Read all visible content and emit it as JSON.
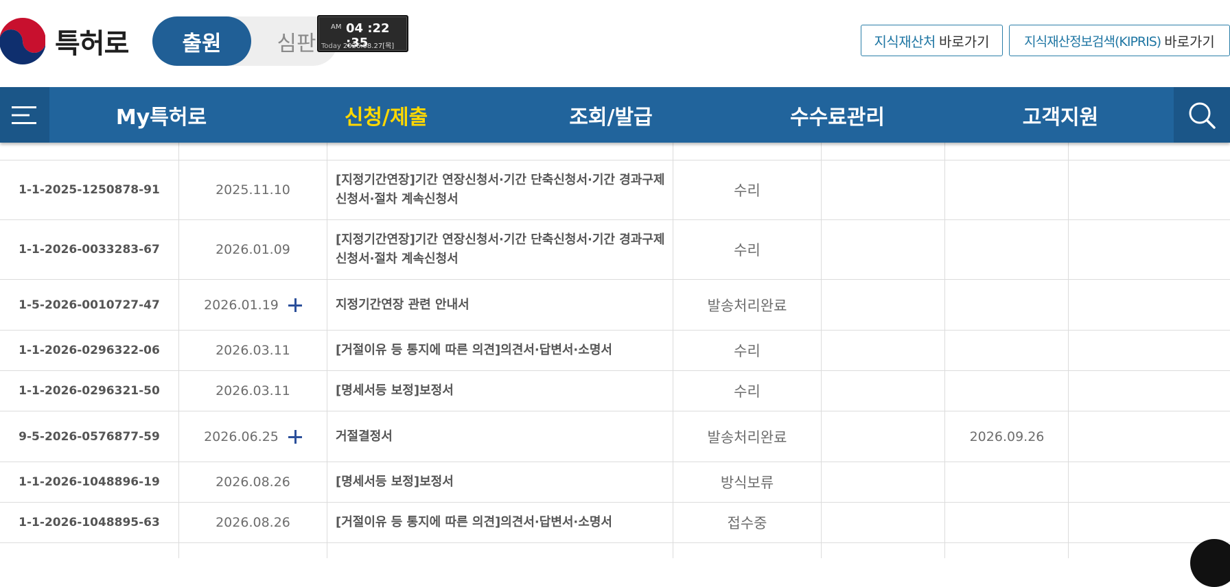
{
  "header": {
    "logo_text": "특허로",
    "modes": {
      "active": "출원",
      "inactive": "심판"
    },
    "clock": {
      "ampm": "AM",
      "time": "04 :22 :35",
      "today_label": "Today",
      "date": "2026.08.27[목]"
    },
    "links": [
      {
        "accent": "지식재산처",
        "suffix": "바로가기"
      },
      {
        "accent": "지식재산정보검색(KIPRIS)",
        "suffix": "바로가기"
      }
    ]
  },
  "nav": {
    "items": [
      {
        "label": "My특허로",
        "active": false
      },
      {
        "label": "신청/제출",
        "active": true
      },
      {
        "label": "조회/발급",
        "active": false
      },
      {
        "label": "수수료관리",
        "active": false
      },
      {
        "label": "고객지원",
        "active": false
      }
    ]
  },
  "table": {
    "rows": [
      {
        "no": "1-1-2025-1250878-91",
        "date": "2025.11.10",
        "doc": "[지정기간연장]기간 연장신청서·기간 단축신청서·기간 경과구제신청서·절차 계속신청서",
        "status": "수리",
        "due": "",
        "expand": false
      },
      {
        "no": "1-1-2026-0033283-67",
        "date": "2026.01.09",
        "doc": "[지정기간연장]기간 연장신청서·기간 단축신청서·기간 경과구제신청서·절차 계속신청서",
        "status": "수리",
        "due": "",
        "expand": false
      },
      {
        "no": "1-5-2026-0010727-47",
        "date": "2026.01.19",
        "doc": "지정기간연장 관련 안내서",
        "status": "발송처리완료",
        "due": "",
        "expand": true
      },
      {
        "no": "1-1-2026-0296322-06",
        "date": "2026.03.11",
        "doc": "[거절이유 등 통지에 따른 의견]의견서·답변서·소명서",
        "status": "수리",
        "due": "",
        "expand": false
      },
      {
        "no": "1-1-2026-0296321-50",
        "date": "2026.03.11",
        "doc": "[명세서등 보정]보정서",
        "status": "수리",
        "due": "",
        "expand": false
      },
      {
        "no": "9-5-2026-0576877-59",
        "date": "2026.06.25",
        "doc": "거절결정서",
        "status": "발송처리완료",
        "due": "2026.09.26",
        "expand": true
      },
      {
        "no": "1-1-2026-1048896-19",
        "date": "2026.08.26",
        "doc": "[명세서등 보정]보정서",
        "status": "방식보류",
        "due": "",
        "expand": false
      },
      {
        "no": "1-1-2026-1048895-63",
        "date": "2026.08.26",
        "doc": "[거절이유 등 통지에 따른 의견]의견서·답변서·소명서",
        "status": "접수중",
        "due": "",
        "expand": false
      }
    ]
  },
  "colors": {
    "nav_bg": "#21649c",
    "nav_active": "#ffd800",
    "mode_active": "#205f96"
  }
}
